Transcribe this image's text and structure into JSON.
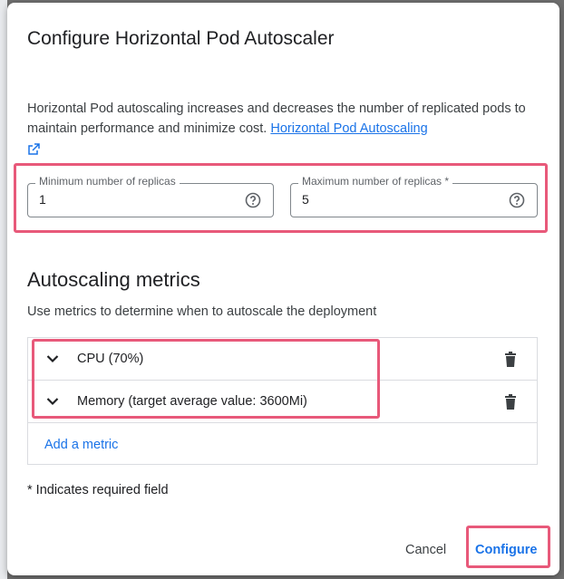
{
  "dialog": {
    "title": "Configure Horizontal Pod Autoscaler",
    "description_text": "Horizontal Pod autoscaling increases and decreases the number of replicated pods to maintain performance and minimize cost.",
    "description_link": "Horizontal Pod Autoscaling"
  },
  "replicas": {
    "min": {
      "label": "Minimum number of replicas",
      "value": "1"
    },
    "max": {
      "label": "Maximum number of replicas *",
      "value": "5"
    }
  },
  "metrics": {
    "title": "Autoscaling metrics",
    "description": "Use metrics to determine when to autoscale the deployment",
    "items": [
      {
        "label": "CPU (70%)"
      },
      {
        "label": "Memory (target average value: 3600Mi)"
      }
    ],
    "add_label": "Add a metric"
  },
  "footer": {
    "required_note": "* Indicates required field",
    "cancel_label": "Cancel",
    "configure_label": "Configure"
  },
  "colors": {
    "accent": "#1a73e8",
    "highlight": "#e8597a"
  },
  "icons": [
    "external-link-icon",
    "help-icon",
    "chevron-down-icon",
    "trash-icon"
  ]
}
